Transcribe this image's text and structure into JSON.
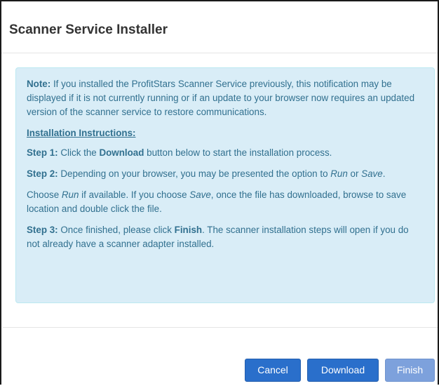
{
  "dialog": {
    "title": "Scanner Service Installer"
  },
  "notice": {
    "note_label": "Note:",
    "note_text": " If you installed the ProfitStars Scanner Service previously, this notification may be displayed if it is not currently running or if an update to your browser now requires an updated version of the scanner service to restore communications.",
    "instructions_heading": "Installation Instructions:",
    "step1_label": "Step 1:",
    "step1_pre": " Click the ",
    "step1_bold": "Download",
    "step1_post": " button below to start the installation process.",
    "step2_label": "Step 2:",
    "step2_pre": " Depending on your browser, you may be presented the option to ",
    "step2_run": "Run",
    "step2_mid": " or ",
    "step2_save": "Save",
    "step2_post": ".",
    "choose_pre": "Choose ",
    "choose_run": "Run",
    "choose_mid": " if available. If you choose ",
    "choose_save": "Save",
    "choose_post": ", once the file has downloaded, browse to save location and double click the file.",
    "step3_label": "Step 3:",
    "step3_pre": " Once finished, please click ",
    "step3_bold": "Finish",
    "step3_post": ". The scanner installation steps will open if you do not already have a scanner adapter installed."
  },
  "footer": {
    "cancel_label": "Cancel",
    "download_label": "Download",
    "finish_label": "Finish"
  },
  "colors": {
    "primary_button": "#2a6fcb",
    "disabled_button": "#7da1dc",
    "info_background": "#d9edf7",
    "info_text": "#31708f"
  }
}
